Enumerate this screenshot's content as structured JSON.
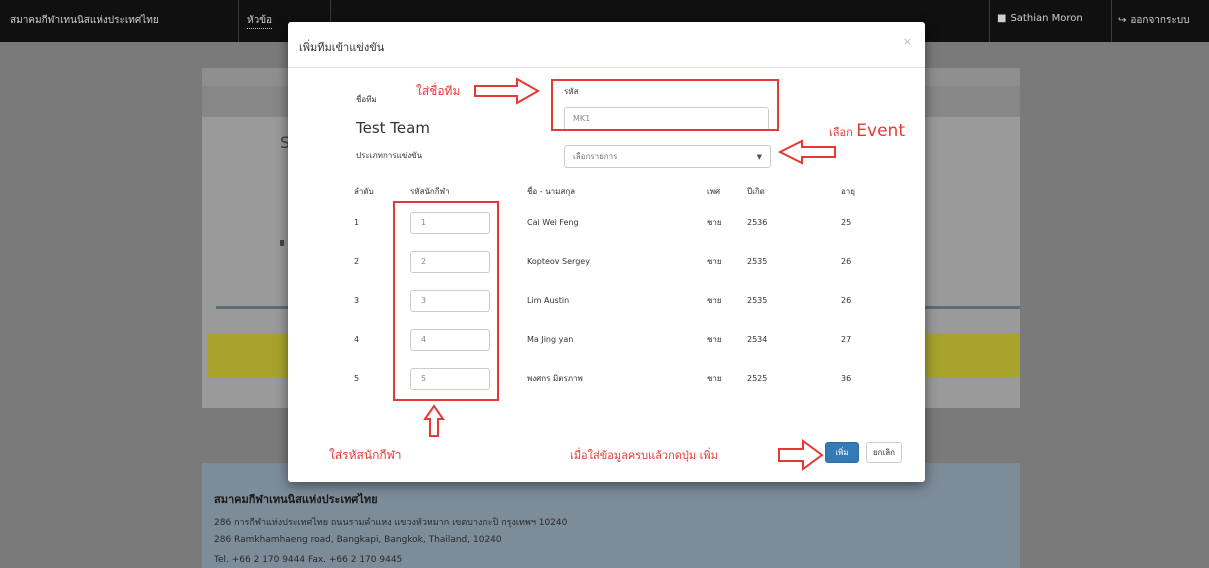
{
  "navbar": {
    "brand": "สมาคมกีฬาเทนนิสแห่งประเทศไทย",
    "link": "หัวข้อ",
    "user": "Sathian Moron",
    "logout": "ออกจากระบบ",
    "user_icon": "user-icon",
    "logout_icon": "logout-icon"
  },
  "background": {
    "letter": "S",
    "footer_title": "สมาคมกีฬาเทนนิสแห่งประเทศไทย",
    "footer_line1": "286 การกีฬาแห่งประเทศไทย ถนนรามคำแหง แขวงหัวหมาก เขตบางกะปิ กรุงเทพฯ 10240",
    "footer_line2": "286 Ramkhamhaeng road, Bangkapi, Bangkok, Thailand, 10240",
    "footer_line3": "Tel. +66 2 170 9444  Fax. +66 2 170 9445"
  },
  "modal": {
    "title": "เพิ่มทีมเข้าแข่งขัน",
    "close": "×",
    "team_label": "ชื่อทีม",
    "team_name": "Test Team",
    "event_label": "ประเภทการแข่งขัน",
    "code_label": "รหัส",
    "code_value": "MK1",
    "event_placeholder": "เลือกรายการ",
    "event_caret": "▼",
    "headers": [
      "ลำดับ",
      "รหัสนักกีฬา",
      "ชื่อ - นามสกุล",
      "เพศ",
      "ปีเกิด",
      "อายุ"
    ],
    "rows": [
      {
        "no": "1",
        "id": "1",
        "name": "Cai Wei Feng",
        "sex": "ชาย",
        "dob": "2536",
        "age": "25"
      },
      {
        "no": "2",
        "id": "2",
        "name": "Kopteov Sergey",
        "sex": "ชาย",
        "dob": "2535",
        "age": "26"
      },
      {
        "no": "3",
        "id": "3",
        "name": "Lim Austin",
        "sex": "ชาย",
        "dob": "2535",
        "age": "26"
      },
      {
        "no": "4",
        "id": "4",
        "name": "Ma Jing yan",
        "sex": "ชาย",
        "dob": "2534",
        "age": "27"
      },
      {
        "no": "5",
        "id": "5",
        "name": "พงศกร มิตรภาพ",
        "sex": "ชาย",
        "dob": "2525",
        "age": "36"
      }
    ],
    "add_button": "เพิ่ม",
    "cancel_button": "ยกเลิก"
  },
  "annotations": {
    "team_name_hint": "ใส่ชื่อทีม",
    "event_hint_prefix": "เลือก",
    "event_hint_word": "Event",
    "id_hint": "ใส่รหัสนักกีฬา",
    "submit_hint": "เมื่อใส่ข้อมูลครบแล้วกดปุ่ม เพิ่ม",
    "color": "#e53935"
  }
}
